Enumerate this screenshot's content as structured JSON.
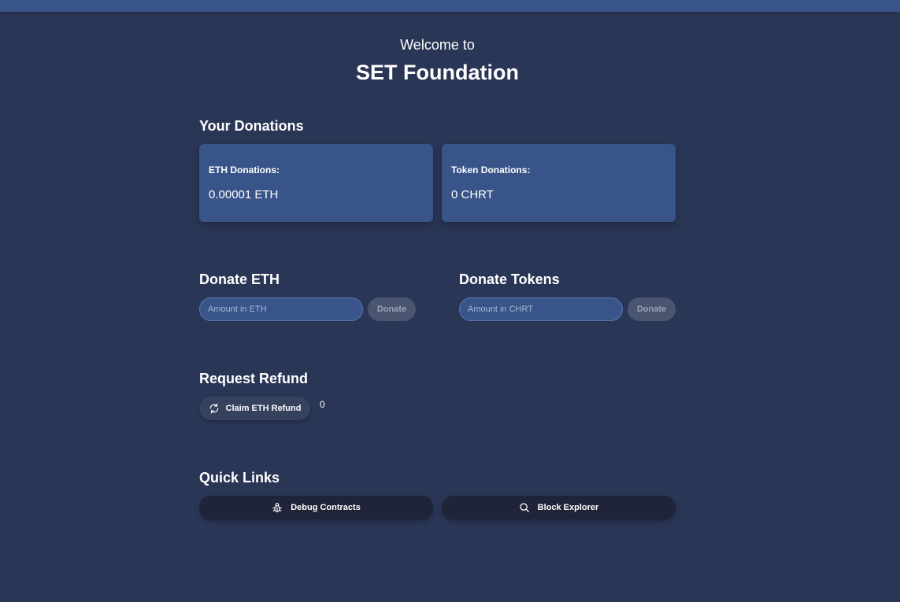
{
  "hero": {
    "welcome": "Welcome to",
    "title": "SET Foundation"
  },
  "donations": {
    "heading": "Your Donations",
    "eth": {
      "label": "ETH Donations:",
      "value": "0.00001 ETH"
    },
    "token": {
      "label": "Token Donations:",
      "value": "0 CHRT"
    }
  },
  "donate_eth": {
    "heading": "Donate ETH",
    "placeholder": "Amount in ETH",
    "button": "Donate"
  },
  "donate_tokens": {
    "heading": "Donate Tokens",
    "placeholder": "Amount in CHRT",
    "button": "Donate"
  },
  "refund": {
    "heading": "Request Refund",
    "button": "Claim ETH Refund",
    "icon": "refresh-icon",
    "value": "0"
  },
  "quick_links": {
    "heading": "Quick Links",
    "debug": {
      "label": "Debug Contracts",
      "icon": "bug-icon"
    },
    "explorer": {
      "label": "Block Explorer",
      "icon": "search-icon"
    }
  },
  "colors": {
    "background": "#2a3655",
    "card": "#385489",
    "dark_button": "#1f2438"
  }
}
